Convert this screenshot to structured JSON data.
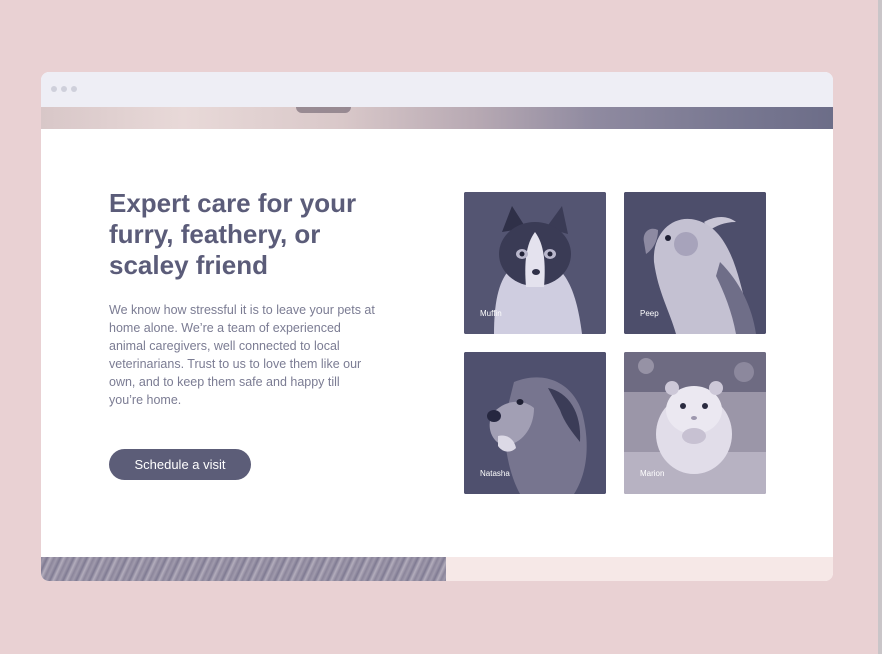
{
  "page": {
    "heading": "Expert care for your furry, feathery, or scaley friend",
    "description": "We know how stressful it is to leave your pets at home alone. We’re a team of experienced animal caregivers, well connected to local veterinarians. Trust to us to love them like our own, and to keep them safe and happy till you’re home.",
    "cta_label": "Schedule a visit"
  },
  "pets": [
    {
      "name": "Muffin",
      "animal": "cat"
    },
    {
      "name": "Peep",
      "animal": "bird"
    },
    {
      "name": "Natasha",
      "animal": "dog"
    },
    {
      "name": "Marion",
      "animal": "hamster"
    }
  ],
  "colors": {
    "background": "#e9d1d3",
    "accent": "#5c5d78",
    "heading": "#5b5c79",
    "text": "#7b7c93",
    "titlebar": "#eeeef5"
  }
}
